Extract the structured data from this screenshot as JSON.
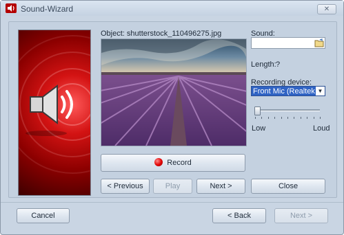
{
  "window": {
    "title": "Sound-Wizard",
    "close_glyph": "✕"
  },
  "object": {
    "label": "Object: shutterstock_110496275.jpg"
  },
  "sound": {
    "label": "Sound:",
    "value": ""
  },
  "length": {
    "label": "Length:",
    "value": "?"
  },
  "recording": {
    "label": "Recording device:",
    "selected": "Front Mic (Realtek HD Audio)"
  },
  "volume": {
    "low_label": "Low",
    "high_label": "Loud",
    "level": 0.02,
    "tick_count": 11
  },
  "buttons": {
    "record": "Record",
    "previous": "< Previous",
    "play": "Play",
    "next_media": "Next >",
    "close": "Close",
    "cancel": "Cancel",
    "back": "< Back",
    "next": "Next >"
  },
  "colors": {
    "accent_red": "#d31313",
    "selection_blue": "#2f63c4",
    "frame": "#c9d5e3"
  },
  "icons": {
    "app": "sound-wizard-icon",
    "browse": "folder-icon",
    "record": "record-dot-icon",
    "banner": "speaker-icon"
  }
}
